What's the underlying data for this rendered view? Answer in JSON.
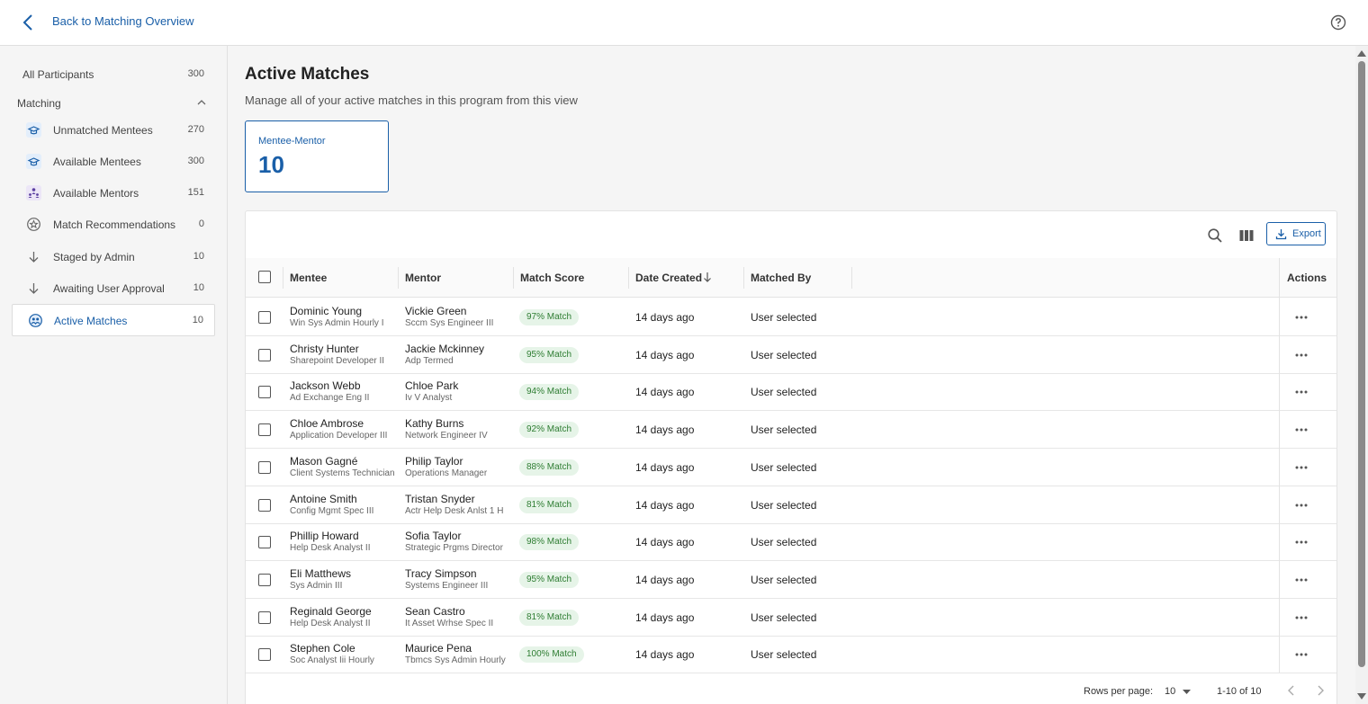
{
  "header": {
    "back_label": "Back to Matching Overview"
  },
  "sidebar": {
    "all": {
      "label": "All Participants",
      "count": "300"
    },
    "section_label": "Matching",
    "items": [
      {
        "label": "Unmatched Mentees",
        "count": "270",
        "icon": "mentee-cap-icon"
      },
      {
        "label": "Available Mentees",
        "count": "300",
        "icon": "mentee-cap-icon"
      },
      {
        "label": "Available Mentors",
        "count": "151",
        "icon": "mentor-group-icon"
      },
      {
        "label": "Match Recommendations",
        "count": "0",
        "icon": "recommendation-icon"
      },
      {
        "label": "Staged by Admin",
        "count": "10",
        "icon": "arrow-down-icon"
      },
      {
        "label": "Awaiting User Approval",
        "count": "10",
        "icon": "arrow-down-icon"
      },
      {
        "label": "Active Matches",
        "count": "10",
        "icon": "active-matches-icon"
      }
    ]
  },
  "main": {
    "title": "Active Matches",
    "subtitle": "Manage all of your active matches in this program from this view",
    "stat": {
      "label": "Mentee-Mentor",
      "value": "10"
    }
  },
  "table": {
    "export_label": "Export",
    "columns": {
      "mentee": "Mentee",
      "mentor": "Mentor",
      "score": "Match Score",
      "date": "Date Created",
      "by": "Matched By",
      "actions": "Actions"
    },
    "rows": [
      {
        "mentee": "Dominic Young",
        "mentee_role": "Win Sys Admin Hourly I",
        "mentor": "Vickie Green",
        "mentor_role": "Sccm Sys Engineer III",
        "score": "97% Match",
        "date": "14 days ago",
        "by": "User selected"
      },
      {
        "mentee": "Christy Hunter",
        "mentee_role": "Sharepoint Developer II",
        "mentor": "Jackie Mckinney",
        "mentor_role": "Adp Termed",
        "score": "95% Match",
        "date": "14 days ago",
        "by": "User selected"
      },
      {
        "mentee": "Jackson Webb",
        "mentee_role": "Ad Exchange Eng II",
        "mentor": "Chloe Park",
        "mentor_role": "Iv V Analyst",
        "score": "94% Match",
        "date": "14 days ago",
        "by": "User selected"
      },
      {
        "mentee": "Chloe Ambrose",
        "mentee_role": "Application Developer III",
        "mentor": "Kathy Burns",
        "mentor_role": "Network Engineer IV",
        "score": "92% Match",
        "date": "14 days ago",
        "by": "User selected"
      },
      {
        "mentee": "Mason Gagné",
        "mentee_role": "Client Systems Technician",
        "mentor": "Philip Taylor",
        "mentor_role": "Operations Manager",
        "score": "88% Match",
        "date": "14 days ago",
        "by": "User selected"
      },
      {
        "mentee": "Antoine Smith",
        "mentee_role": "Config Mgmt Spec III",
        "mentor": "Tristan Snyder",
        "mentor_role": "Actr Help Desk Anlst 1 H",
        "score": "81% Match",
        "date": "14 days ago",
        "by": "User selected"
      },
      {
        "mentee": "Phillip Howard",
        "mentee_role": "Help Desk Analyst II",
        "mentor": "Sofia Taylor",
        "mentor_role": "Strategic Prgms Director",
        "score": "98% Match",
        "date": "14 days ago",
        "by": "User selected"
      },
      {
        "mentee": "Eli Matthews",
        "mentee_role": "Sys Admin III",
        "mentor": "Tracy Simpson",
        "mentor_role": "Systems Engineer III",
        "score": "95% Match",
        "date": "14 days ago",
        "by": "User selected"
      },
      {
        "mentee": "Reginald George",
        "mentee_role": "Help Desk Analyst II",
        "mentor": "Sean Castro",
        "mentor_role": "It Asset Wrhse Spec II",
        "score": "81% Match",
        "date": "14 days ago",
        "by": "User selected"
      },
      {
        "mentee": "Stephen Cole",
        "mentee_role": "Soc Analyst Iii Hourly",
        "mentor": "Maurice Pena",
        "mentor_role": "Tbmcs Sys Admin Hourly",
        "score": "100% Match",
        "date": "14 days ago",
        "by": "User selected"
      }
    ],
    "footer": {
      "rows_per_page_label": "Rows per page:",
      "rows_per_page": "10",
      "range": "1-10 of 10"
    }
  },
  "colors": {
    "accent": "#1a5fa8",
    "badge_bg": "#e6f4e8",
    "badge_text": "#2e7d32"
  }
}
